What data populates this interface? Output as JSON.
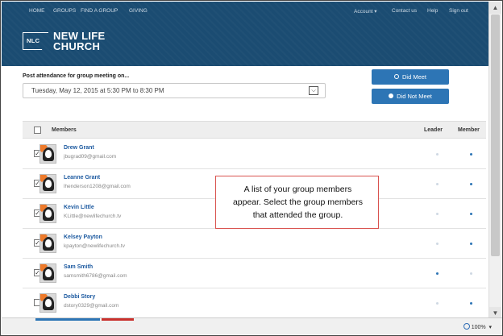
{
  "topnav": {
    "home": "HOME",
    "groups": "GROUPS",
    "find_group": "FIND A GROUP",
    "giving": "GIVING",
    "account": "Account ▾",
    "contact": "Contact us",
    "help": "Help",
    "signout": "Sign out"
  },
  "logo": {
    "mark": "NLC",
    "line1": "NEW LIFE",
    "line2": "CHURCH"
  },
  "attendance": {
    "label": "Post attendance for group meeting on...",
    "selected_date": "Tuesday, May 12, 2015 at 5:30 PM to 8:30 PM"
  },
  "buttons": {
    "did_meet": "Did Meet",
    "did_not_meet": "Did Not Meet"
  },
  "table": {
    "header_members": "Members",
    "header_leader": "Leader",
    "header_member": "Member",
    "rows": [
      {
        "name": "Drew Grant",
        "email": "jbugrad09@gmail.com",
        "checked": "✓",
        "leader": false,
        "member": true
      },
      {
        "name": "Leanne Grant",
        "email": "lhenderson1208@gmail.com",
        "checked": "✓",
        "leader": false,
        "member": true
      },
      {
        "name": "Kevin Little",
        "email": "KLittle@newlifechurch.tv",
        "checked": "✓",
        "leader": false,
        "member": true
      },
      {
        "name": "Kelsey Payton",
        "email": "kpayton@newlifechurch.tv",
        "checked": "✓",
        "leader": false,
        "member": true
      },
      {
        "name": "Sam Smith",
        "email": "samsmith6786@gmail.com",
        "checked": "✓",
        "leader": true,
        "member": false
      },
      {
        "name": "Debbi Story",
        "email": "dstory0329@gmail.com",
        "checked": "",
        "leader": false,
        "member": true
      }
    ]
  },
  "tooltip": {
    "line1": "A list of your group members",
    "line2": "appear.  Select the group members",
    "line3": "that attended the group."
  },
  "statusbar": {
    "zoom": "100%",
    "zoom_arrow": "▾"
  },
  "colors": {
    "header_bg": "#1b4c72",
    "primary": "#2d75b5",
    "link": "#1d5aa0",
    "tooltip_border": "#d9534f"
  }
}
